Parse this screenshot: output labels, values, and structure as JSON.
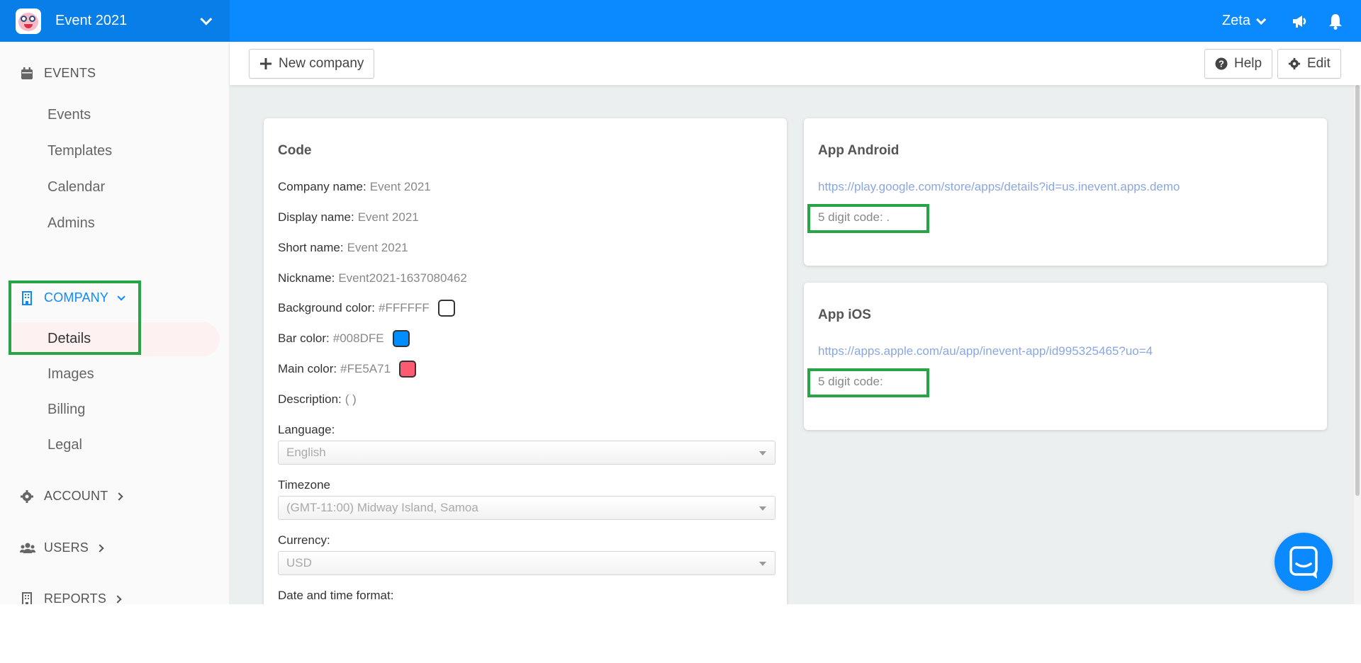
{
  "topbar": {
    "event_title": "Event 2021",
    "user_name": "Zeta"
  },
  "sidebar": {
    "events_section": "EVENTS",
    "events_items": [
      "Events",
      "Templates",
      "Calendar",
      "Admins"
    ],
    "company_section": "COMPANY",
    "company_items": [
      "Details",
      "Images",
      "Billing",
      "Legal"
    ],
    "account_section": "ACCOUNT",
    "users_section": "USERS",
    "reports_section": "REPORTS"
  },
  "toolbar": {
    "new_company_label": "New company",
    "help_label": "Help",
    "edit_label": "Edit"
  },
  "code_card": {
    "title": "Code",
    "company_name_label": "Company name:",
    "company_name_value": "Event 2021",
    "display_name_label": "Display name:",
    "display_name_value": "Event 2021",
    "short_name_label": "Short name:",
    "short_name_value": "Event 2021",
    "nickname_label": "Nickname:",
    "nickname_value": "Event2021-1637080462",
    "background_color_label": "Background color:",
    "background_color_value": "#FFFFFF",
    "bar_color_label": "Bar color:",
    "bar_color_value": "#008DFE",
    "main_color_label": "Main color:",
    "main_color_value": "#FE5A71",
    "description_label": "Description:",
    "description_value": "( )",
    "language_label": "Language:",
    "language_value": "English",
    "timezone_label": "Timezone",
    "timezone_value": "(GMT-11:00) Midway Island, Samoa",
    "currency_label": "Currency:",
    "currency_value": "USD",
    "date_format_label": "Date and time format:"
  },
  "android_card": {
    "title": "App Android",
    "url": "https://play.google.com/store/apps/details?id=us.inevent.apps.demo",
    "digit_label": "5 digit code: ."
  },
  "ios_card": {
    "title": "App iOS",
    "url": "https://apps.apple.com/au/app/inevent-app/id995325465?uo=4",
    "digit_label": "5 digit code:"
  },
  "colors": {
    "brand_blue": "#0a8afe",
    "highlight_green": "#26a446",
    "bar_color": "#008DFE",
    "main_color": "#FE5A71",
    "background_color": "#FFFFFF"
  },
  "icons": [
    "logo",
    "chevron-down-icon",
    "megaphone-icon",
    "bell-icon",
    "calendar-icon",
    "building-icon",
    "gear-icon",
    "users-icon",
    "plus-icon",
    "question-icon",
    "chat-icon"
  ]
}
